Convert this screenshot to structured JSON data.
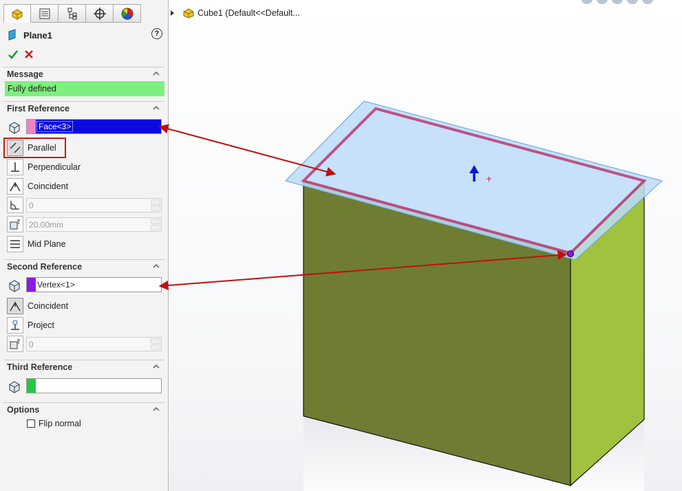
{
  "property_manager": {
    "title": "Plane1",
    "message_header": "Message",
    "message_text": "Fully defined",
    "first_ref": {
      "header": "First Reference",
      "selection": "Face<3>",
      "swatch": "#f080c8",
      "options": {
        "parallel": "Parallel",
        "perpendicular": "Perpendicular",
        "coincident": "Coincident",
        "mid_plane": "Mid Plane"
      },
      "angle_value": "0",
      "distance_value": "20.00mm"
    },
    "second_ref": {
      "header": "Second Reference",
      "selection": "Vertex<1>",
      "swatch": "#8a18e8",
      "options": {
        "coincident": "Coincident",
        "project": "Project"
      },
      "value": "0"
    },
    "third_ref": {
      "header": "Third Reference",
      "swatch": "#22c844"
    },
    "options": {
      "header": "Options",
      "flip_normal": "Flip normal"
    }
  },
  "feature_tree": {
    "item": "Cube1  (Default<<Default..."
  },
  "colors": {
    "accent_selection": "#0a0adf",
    "message_ok": "#7df07d",
    "arrow": "#c01010",
    "plane": "#bcdcf8"
  }
}
